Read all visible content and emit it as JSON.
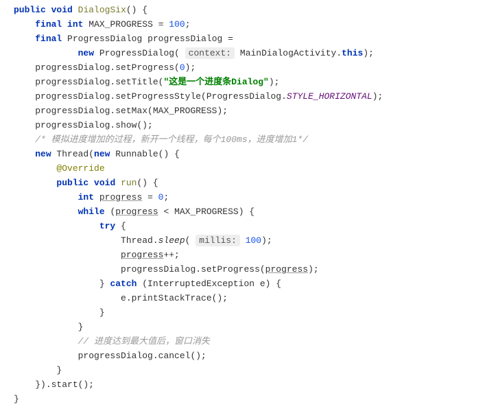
{
  "l1": {
    "kw1": "public",
    "kw2": "void",
    "name": "DialogSix",
    "p": "() {"
  },
  "l2": {
    "kw1": "final",
    "kw2": "int",
    "var": "MAX_PROGRESS",
    "eq": " = ",
    "num": "100",
    "semi": ";"
  },
  "l3": {
    "kw": "final",
    "type": "ProgressDialog ",
    "var": "progressDialog",
    " eq": " ="
  },
  "l4": {
    "kw": "new",
    "type": "ProgressDialog",
    "open": "( ",
    "hint": "context:",
    "arg": " MainDialogActivity.",
    "thiskw": "this",
    "close": ");"
  },
  "l5": {
    "txt": "progressDialog.setProgress(",
    "num": "0",
    "close": ");"
  },
  "l6": {
    "txt": "progressDialog.setTitle(",
    "str": "\"这是一个进度条Dialog\"",
    "close": ");"
  },
  "l7": {
    "txt": "progressDialog.setProgressStyle(ProgressDialog.",
    "c": "STYLE_HORIZONTAL",
    "close": ");"
  },
  "l8": {
    "txt": "progressDialog.setMax(MAX_PROGRESS);"
  },
  "l9": {
    "txt": "progressDialog.show();"
  },
  "l10": {
    "c": "/* 模拟进度增加的过程，新开一个线程，每个100ms，进度增加1*/"
  },
  "l11": {
    "kw1": "new",
    "type": " Thread(",
    "kw2": "new",
    "type2": " Runnable() {"
  },
  "l12": {
    "anno": "@Override"
  },
  "l13": {
    "kw1": "public",
    "kw2": "void",
    "name": "run",
    "p": "() {"
  },
  "l14": {
    "kw": "int",
    "var": "progress",
    "eq": " = ",
    "num": "0",
    "semi": ";"
  },
  "l15": {
    "kw": "while",
    "open": " (",
    "var": "progress",
    "lt": " < ",
    "max": "MAX_PROGRESS",
    ") ": ") {"
  },
  "l16": {
    "kw": "try",
    "b": " {"
  },
  "l17": {
    "txt": "Thread.",
    "m": "sleep",
    "open": "( ",
    "hint": "millis:",
    "sp": " ",
    "num": "100",
    "close": ");"
  },
  "l18": {
    "var": "progress",
    "pp": "++;"
  },
  "l19": {
    "txt": "progressDialog.setProgress(",
    "var": "progress",
    "close": ");"
  },
  "l20": {
    "close": "} ",
    "kw": "catch",
    "open": " (InterruptedException e) {"
  },
  "l21": {
    "txt": "e.printStackTrace();"
  },
  "l22": {
    "b": "}"
  },
  "l23": {
    "b": "}"
  },
  "l24": {
    "c": "// 进度达到最大值后，窗口消失"
  },
  "l25": {
    "txt": "progressDialog.cancel();"
  },
  "l26": {
    "b": "}"
  },
  "l27": {
    "txt": "}).start();"
  },
  "l28": {
    "b": "}"
  }
}
